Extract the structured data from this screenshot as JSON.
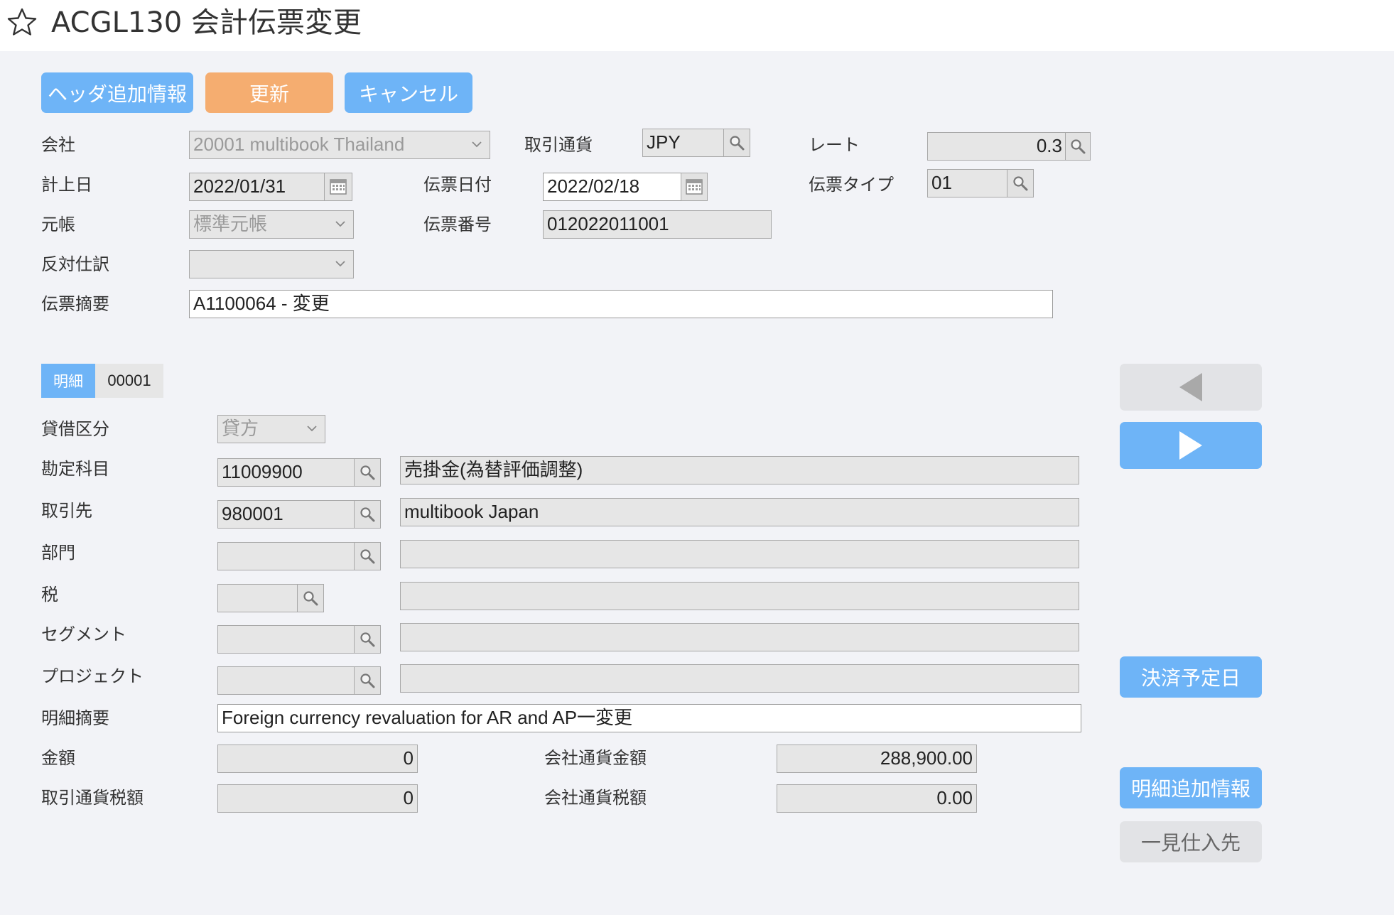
{
  "header": {
    "title": "ACGL130 会計伝票変更"
  },
  "toolbar": {
    "header_info": "ヘッダ追加情報",
    "update": "更新",
    "cancel": "キャンセル"
  },
  "form": {
    "company": {
      "label": "会社",
      "value": "20001 multibook Thailand"
    },
    "currency": {
      "label": "取引通貨",
      "value": "JPY"
    },
    "rate": {
      "label": "レート",
      "value": "0.3"
    },
    "posting_date": {
      "label": "計上日",
      "value": "2022/01/31"
    },
    "slip_date": {
      "label": "伝票日付",
      "value": "2022/02/18"
    },
    "slip_type": {
      "label": "伝票タイプ",
      "value": "01"
    },
    "ledger": {
      "label": "元帳",
      "value": "標準元帳"
    },
    "slip_number": {
      "label": "伝票番号",
      "value": "012022011001"
    },
    "reverse_entry": {
      "label": "反対仕訳",
      "value": ""
    },
    "slip_summary": {
      "label": "伝票摘要",
      "value": "A1100064 - 変更"
    }
  },
  "detail": {
    "tab_label": "明細",
    "tab_number": "00001",
    "debit_credit": {
      "label": "貸借区分",
      "value": "貸方"
    },
    "account": {
      "label": "勘定科目",
      "code": "11009900",
      "name": "売掛金(為替評価調整)"
    },
    "partner": {
      "label": "取引先",
      "code": "980001",
      "name": "multibook Japan"
    },
    "department": {
      "label": "部門",
      "code": "",
      "name": ""
    },
    "tax": {
      "label": "税",
      "code": "",
      "name": ""
    },
    "segment": {
      "label": "セグメント",
      "code": "",
      "name": ""
    },
    "project": {
      "label": "プロジェクト",
      "code": "",
      "name": ""
    },
    "line_summary": {
      "label": "明細摘要",
      "value": "Foreign currency revaluation for AR and AP一変更"
    },
    "amount": {
      "label": "金額",
      "value": "0"
    },
    "company_amount": {
      "label": "会社通貨金額",
      "value": "288,900.00"
    },
    "tax_amount": {
      "label": "取引通貨税額",
      "value": "0"
    },
    "company_tax_amount": {
      "label": "会社通貨税額",
      "value": "0.00"
    }
  },
  "side": {
    "settlement_date": "決済予定日",
    "detail_info": "明細追加情報",
    "supplier": "一見仕入先"
  },
  "colors": {
    "accent_blue": "#6eb4f7",
    "accent_orange": "#f5ad70",
    "field_grey": "#e6e6e6"
  },
  "icons": [
    "star-icon",
    "search-icon",
    "calendar-icon",
    "chevron-down-icon",
    "arrow-left-icon",
    "arrow-right-icon"
  ]
}
